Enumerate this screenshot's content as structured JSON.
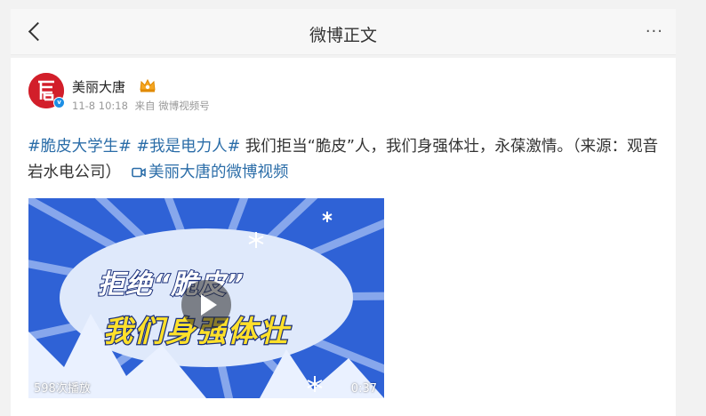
{
  "header": {
    "title": "微博正文",
    "more_label": "···"
  },
  "post": {
    "user_name": "美丽大唐",
    "time": "11-8 10:18",
    "source": "来自 微博视频号",
    "tags": [
      "#脆皮大学生#",
      "#我是电力人#"
    ],
    "body": " 我们拒当“脆皮”人，我们身强体壮，永葆激情。（来源：观音岩水电公司）",
    "video_link_label": "美丽大唐的微博视频",
    "video": {
      "caption_line1": "拒绝“脆皮”",
      "caption_line2": "我们身强体壮",
      "play_count": "598次播放",
      "duration": "0:37"
    }
  },
  "colors": {
    "link": "#2b6da8",
    "avatar_bg": "#d21e2a",
    "video_bg": "#2f62d6",
    "verified": "#1d8fe5"
  },
  "icons": [
    "back-arrow-icon",
    "more-icon",
    "avatar-logo",
    "verified-icon",
    "crown-icon",
    "video-link-icon",
    "play-icon",
    "snowflake-icon"
  ]
}
